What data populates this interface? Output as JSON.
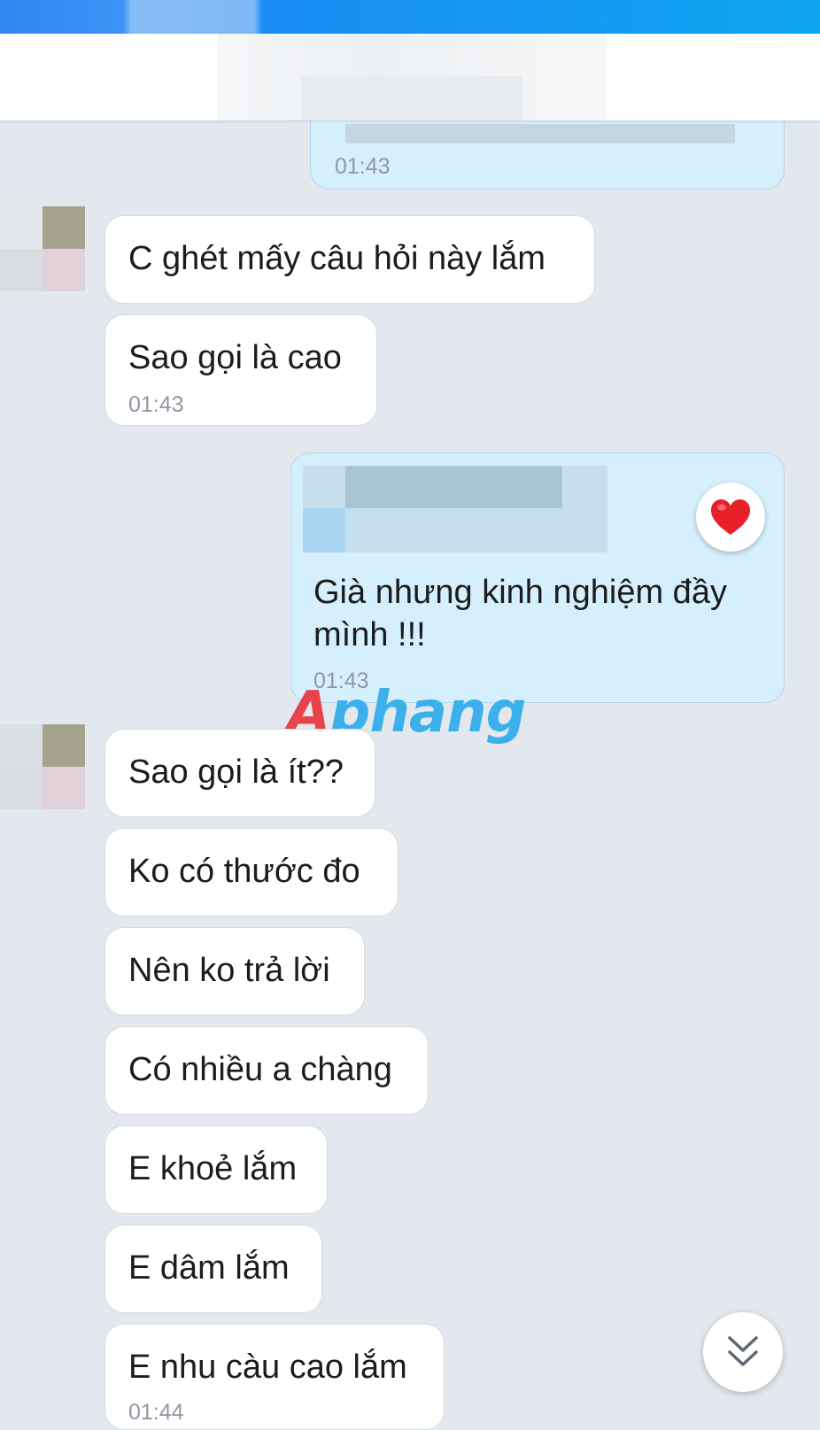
{
  "colors": {
    "chat_background": "#e3e8ee",
    "incoming_bubble": "#ffffff",
    "outgoing_bubble": "#d5effd",
    "accent": "#1a8cf2",
    "heart": "#e8202a"
  },
  "messages": {
    "m0": {
      "text": "",
      "time": "01:43"
    },
    "m1": {
      "text": "C ghét mấy câu hỏi này lắm"
    },
    "m2": {
      "text": "Sao gọi là cao",
      "time": "01:43"
    },
    "m3": {
      "text_line1": "Già nhưng kinh nghiệm đầy",
      "text_line2": "mình !!!",
      "time": "01:43",
      "reaction": "heart-icon"
    },
    "m4": {
      "text": "Sao gọi là ít??"
    },
    "m5": {
      "text": "Ko có thước đo"
    },
    "m6": {
      "text": "Nên ko trả lời"
    },
    "m7": {
      "text": "Có nhiều a chàng"
    },
    "m8": {
      "text": "E khoẻ lắm"
    },
    "m9": {
      "text": "E dâm lắm"
    },
    "m10": {
      "text": "E nhu càu cao lắm",
      "time": "01:44"
    }
  },
  "watermark": {
    "part1": "A",
    "part2": "phang"
  },
  "icons": {
    "scroll_down": "double-chevron-down-icon",
    "reaction": "heart-icon"
  }
}
